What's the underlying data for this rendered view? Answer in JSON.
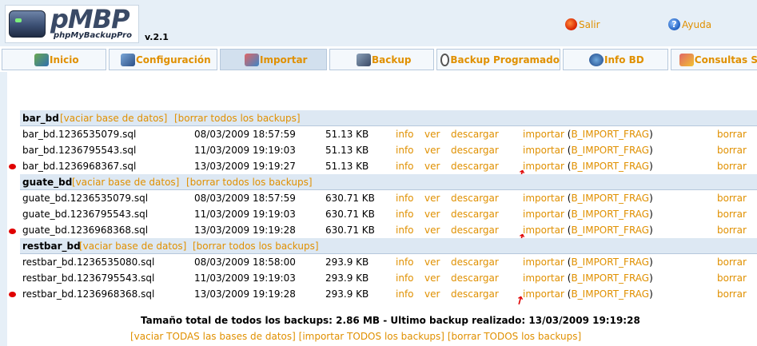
{
  "header": {
    "logo_name": "pMBP",
    "logo_sub": "phpMyBackupPro",
    "version": "v.2.1",
    "salir": "Salir",
    "ayuda": "Ayuda"
  },
  "nav": {
    "tabs": [
      {
        "label": "Inicio"
      },
      {
        "label": "Configuración"
      },
      {
        "label": "Importar"
      },
      {
        "label": "Backup"
      },
      {
        "label": "Backup Programado"
      },
      {
        "label": "Info BD"
      },
      {
        "label": "Consultas S"
      }
    ]
  },
  "groups": [
    {
      "name": "bar_bd",
      "vaciar": "[vaciar base de datos]",
      "borrar_todos": "[borrar todos los backups]",
      "files": [
        {
          "name": "bar_bd.1236535079.sql",
          "date": "08/03/2009 18:57:59",
          "size": "51.13 KB"
        },
        {
          "name": "bar_bd.1236795543.sql",
          "date": "11/03/2009 19:19:03",
          "size": "51.13 KB"
        },
        {
          "name": "bar_bd.1236968367.sql",
          "date": "13/03/2009 19:19:27",
          "size": "51.13 KB"
        }
      ]
    },
    {
      "name": "guate_bd",
      "vaciar": "[vaciar base de datos]",
      "borrar_todos": "[borrar todos los backups]",
      "files": [
        {
          "name": "guate_bd.1236535079.sql",
          "date": "08/03/2009 18:57:59",
          "size": "630.71 KB"
        },
        {
          "name": "guate_bd.1236795543.sql",
          "date": "11/03/2009 19:19:03",
          "size": "630.71 KB"
        },
        {
          "name": "guate_bd.1236968368.sql",
          "date": "13/03/2009 19:19:28",
          "size": "630.71 KB"
        }
      ]
    },
    {
      "name": "restbar_bd",
      "vaciar": "[vaciar base de datos]",
      "borrar_todos": "[borrar todos los backups]",
      "files": [
        {
          "name": "restbar_bd.1236535080.sql",
          "date": "08/03/2009 18:58:00",
          "size": "293.9 KB"
        },
        {
          "name": "restbar_bd.1236795543.sql",
          "date": "11/03/2009 19:19:03",
          "size": "293.9 KB"
        },
        {
          "name": "restbar_bd.1236968368.sql",
          "date": "13/03/2009 19:19:28",
          "size": "293.9 KB"
        }
      ]
    }
  ],
  "actions": {
    "info": "info",
    "ver": "ver",
    "descargar": "descargar",
    "importar": "importar",
    "paren_open": "(",
    "frag": "B_IMPORT_FRAG",
    "paren_close": ")",
    "borrar": "borrar"
  },
  "footer": {
    "total": "Tamaño total de todos los backups: 2.86 MB - Ultimo backup realizado: 13/03/2009 19:19:28",
    "vaciar_todas": "[vaciar TODAS las bases de datos]",
    "importar_todos": "[importar TODOS los backups]",
    "borrar_todos": "[borrar TODOS los backups]"
  }
}
